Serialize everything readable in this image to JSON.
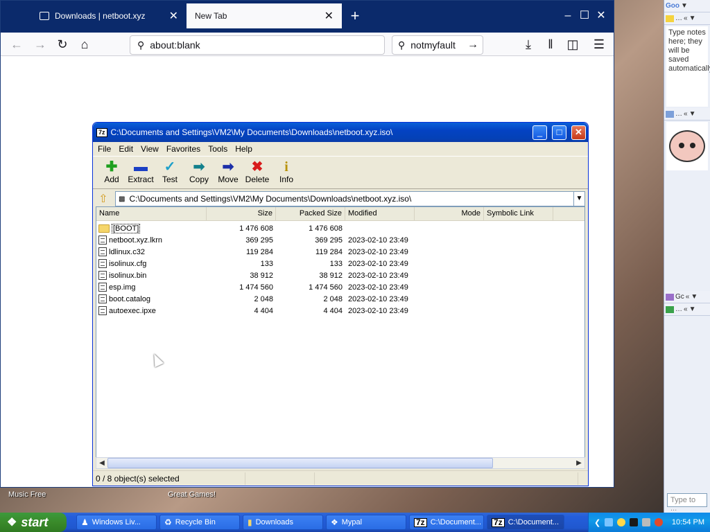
{
  "desktop": {
    "labels": [
      "Music Free",
      "Great Games!"
    ]
  },
  "firefox": {
    "tabs": [
      {
        "title": "Downloads | netboot.xyz",
        "active": false
      },
      {
        "title": "New Tab",
        "active": true
      }
    ],
    "new_tab_symbol": "+",
    "window_buttons": [
      "–",
      "☐",
      "✕"
    ],
    "url": "about:blank",
    "search_text": "notmyfault",
    "icons": {
      "back": "back-arrow-icon",
      "forward": "forward-arrow-icon",
      "reload": "reload-icon",
      "home": "home-icon",
      "downloads": "download-icon",
      "library": "library-icon",
      "sidebar": "sidebar-icon",
      "menu": "hamburger-menu-icon"
    }
  },
  "sevenzip": {
    "title": "C:\\Documents and Settings\\VM2\\My Documents\\Downloads\\netboot.xyz.iso\\",
    "badge": "7z",
    "menu": [
      "File",
      "Edit",
      "View",
      "Favorites",
      "Tools",
      "Help"
    ],
    "toolbar": [
      {
        "label": "Add",
        "icon": "add-plus-icon",
        "glyph": "✚",
        "color": "#1fa01f"
      },
      {
        "label": "Extract",
        "icon": "extract-minus-icon",
        "glyph": "▬",
        "color": "#1b3fc4"
      },
      {
        "label": "Test",
        "icon": "test-check-icon",
        "glyph": "✓",
        "color": "#1ea0c9"
      },
      {
        "label": "Copy",
        "icon": "copy-arrow-icon",
        "glyph": "➡",
        "color": "#12808c"
      },
      {
        "label": "Move",
        "icon": "move-arrow-icon",
        "glyph": "➡",
        "color": "#1c2fa8"
      },
      {
        "label": "Delete",
        "icon": "delete-x-icon",
        "glyph": "✖",
        "color": "#d81b1b"
      },
      {
        "label": "Info",
        "icon": "info-icon",
        "glyph": "i",
        "color": "#b8930c"
      }
    ],
    "address": "C:\\Documents and Settings\\VM2\\My Documents\\Downloads\\netboot.xyz.iso\\",
    "columns": [
      "Name",
      "Size",
      "Packed Size",
      "Modified",
      "Mode",
      "Symbolic Link"
    ],
    "files": [
      {
        "name": "[BOOT]",
        "size": "1 476 608",
        "packed": "1 476 608",
        "modified": "",
        "type": "folder"
      },
      {
        "name": "netboot.xyz.lkrn",
        "size": "369 295",
        "packed": "369 295",
        "modified": "2023-02-10 23:49",
        "type": "file"
      },
      {
        "name": "ldlinux.c32",
        "size": "119 284",
        "packed": "119 284",
        "modified": "2023-02-10 23:49",
        "type": "file"
      },
      {
        "name": "isolinux.cfg",
        "size": "133",
        "packed": "133",
        "modified": "2023-02-10 23:49",
        "type": "file"
      },
      {
        "name": "isolinux.bin",
        "size": "38 912",
        "packed": "38 912",
        "modified": "2023-02-10 23:49",
        "type": "file"
      },
      {
        "name": "esp.img",
        "size": "1 474 560",
        "packed": "1 474 560",
        "modified": "2023-02-10 23:49",
        "type": "file"
      },
      {
        "name": "boot.catalog",
        "size": "2 048",
        "packed": "2 048",
        "modified": "2023-02-10 23:49",
        "type": "file"
      },
      {
        "name": "autoexec.ipxe",
        "size": "4 404",
        "packed": "4 404",
        "modified": "2023-02-10 23:49",
        "type": "file"
      }
    ],
    "status": "0 / 8 object(s) selected"
  },
  "sidebar": {
    "search_header": "Goo",
    "notes_text": "Type notes here; they will be saved automatically.",
    "gadget_short": "Gc",
    "search_placeholder": "Type to ..."
  },
  "taskbar": {
    "start_label": "start",
    "buttons": [
      {
        "label": "Windows Liv...",
        "icon": "messenger-icon",
        "active": false
      },
      {
        "label": "Recycle Bin",
        "icon": "recycle-bin-icon",
        "active": false
      },
      {
        "label": "Downloads",
        "icon": "folder-icon",
        "active": false
      },
      {
        "label": "Mypal",
        "icon": "mypal-browser-icon",
        "active": false
      },
      {
        "label": "C:\\Document...",
        "icon": "7zip-icon",
        "active": false
      },
      {
        "label": "C:\\Document...",
        "icon": "7zip-icon",
        "active": true
      }
    ],
    "clock": "10:54 PM"
  }
}
